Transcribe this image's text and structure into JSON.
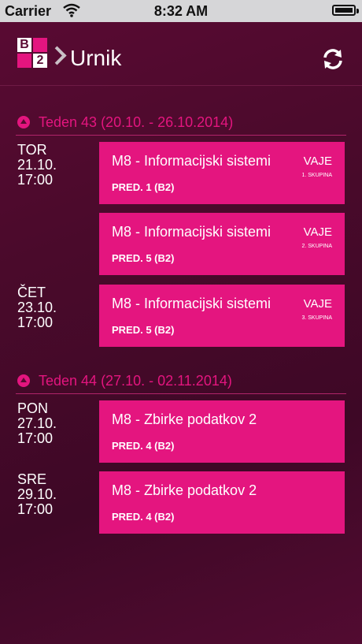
{
  "status_bar": {
    "carrier": "Carrier",
    "time": "8:32 AM"
  },
  "nav": {
    "title": "Urnik",
    "logo_letter": "B",
    "logo_number": "2"
  },
  "weeks": [
    {
      "label": "Teden 43 (20.10. - 26.10.2014)",
      "days": [
        {
          "day": "TOR",
          "date": "21.10.",
          "time": "17:00"
        },
        {
          "day": "ČET",
          "date": "23.10.",
          "time": "17:00"
        }
      ],
      "lectures": [
        {
          "title": "M8 - Informacijski sistemi",
          "room": "PRED. 1 (B2)",
          "type": "VAJE",
          "group": "1. SKUPINA"
        },
        {
          "title": "M8 - Informacijski sistemi",
          "room": "PRED. 5 (B2)",
          "type": "VAJE",
          "group": "2. SKUPINA"
        },
        {
          "title": "M8 - Informacijski sistemi",
          "room": "PRED. 5 (B2)",
          "type": "VAJE",
          "group": "3. SKUPINA"
        }
      ]
    },
    {
      "label": "Teden 44 (27.10. - 02.11.2014)",
      "days": [
        {
          "day": "PON",
          "date": "27.10.",
          "time": "17:00"
        },
        {
          "day": "SRE",
          "date": "29.10.",
          "time": "17:00"
        }
      ],
      "lectures": [
        {
          "title": "M8 - Zbirke podatkov 2",
          "room": "PRED. 4 (B2)",
          "type": "",
          "group": ""
        },
        {
          "title": "M8 - Zbirke podatkov 2",
          "room": "PRED. 4 (B2)",
          "type": "",
          "group": ""
        }
      ]
    }
  ],
  "colors": {
    "accent": "#e4157f",
    "background": "#4a0a2b"
  }
}
